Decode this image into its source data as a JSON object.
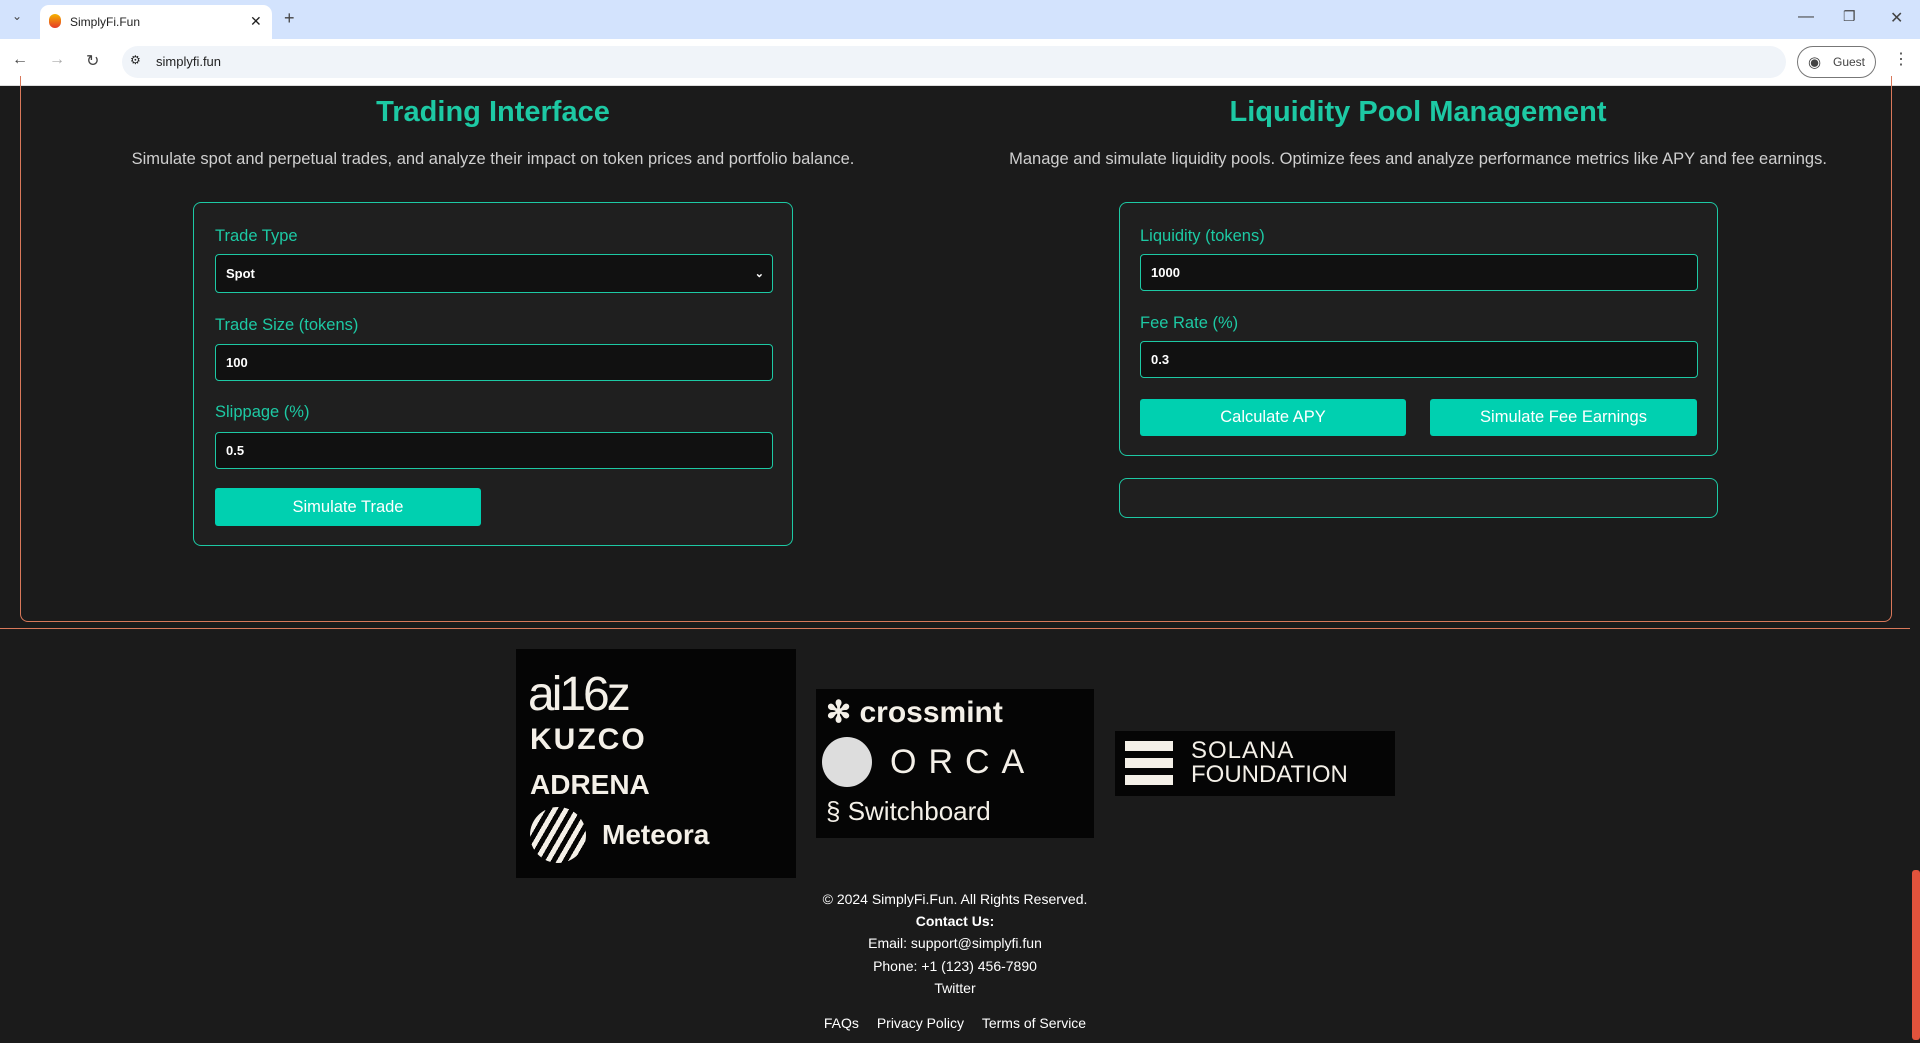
{
  "browser": {
    "tab_title": "SimplyFi.Fun",
    "url": "simplyfi.fun",
    "profile": "Guest"
  },
  "trading": {
    "title": "Trading Interface",
    "subtitle": "Simulate spot and perpetual trades, and analyze their impact on token prices and portfolio balance.",
    "trade_type_label": "Trade Type",
    "trade_type_value": "Spot",
    "trade_size_label": "Trade Size (tokens)",
    "trade_size_value": "100",
    "slippage_label": "Slippage (%)",
    "slippage_value": "0.5",
    "simulate_button": "Simulate Trade"
  },
  "liquidity": {
    "title": "Liquidity Pool Management",
    "subtitle": "Manage and simulate liquidity pools. Optimize fees and analyze performance metrics like APY and fee earnings.",
    "liquidity_label": "Liquidity (tokens)",
    "liquidity_value": "1000",
    "fee_label": "Fee Rate (%)",
    "fee_value": "0.3",
    "apy_button": "Calculate APY",
    "fee_button": "Simulate Fee Earnings"
  },
  "partners": {
    "group1": [
      "ai16z",
      "KUZCO",
      "ADRENA",
      "Meteora"
    ],
    "group2": [
      "crossmint",
      "ORCA",
      "Switchboard"
    ],
    "group3": [
      "SOLANA",
      "FOUNDATION"
    ]
  },
  "footer": {
    "copyright": "© 2024 SimplyFi.Fun. All Rights Reserved.",
    "contact_heading": "Contact Us:",
    "email": "Email: support@simplyfi.fun",
    "phone": "Phone: +1 (123) 456-7890",
    "twitter": "Twitter",
    "links": [
      "FAQs",
      "Privacy Policy",
      "Terms of Service"
    ]
  },
  "colors": {
    "accent": "#1dc9a4",
    "button": "#00d0b0",
    "section_border": "#d9785a"
  }
}
